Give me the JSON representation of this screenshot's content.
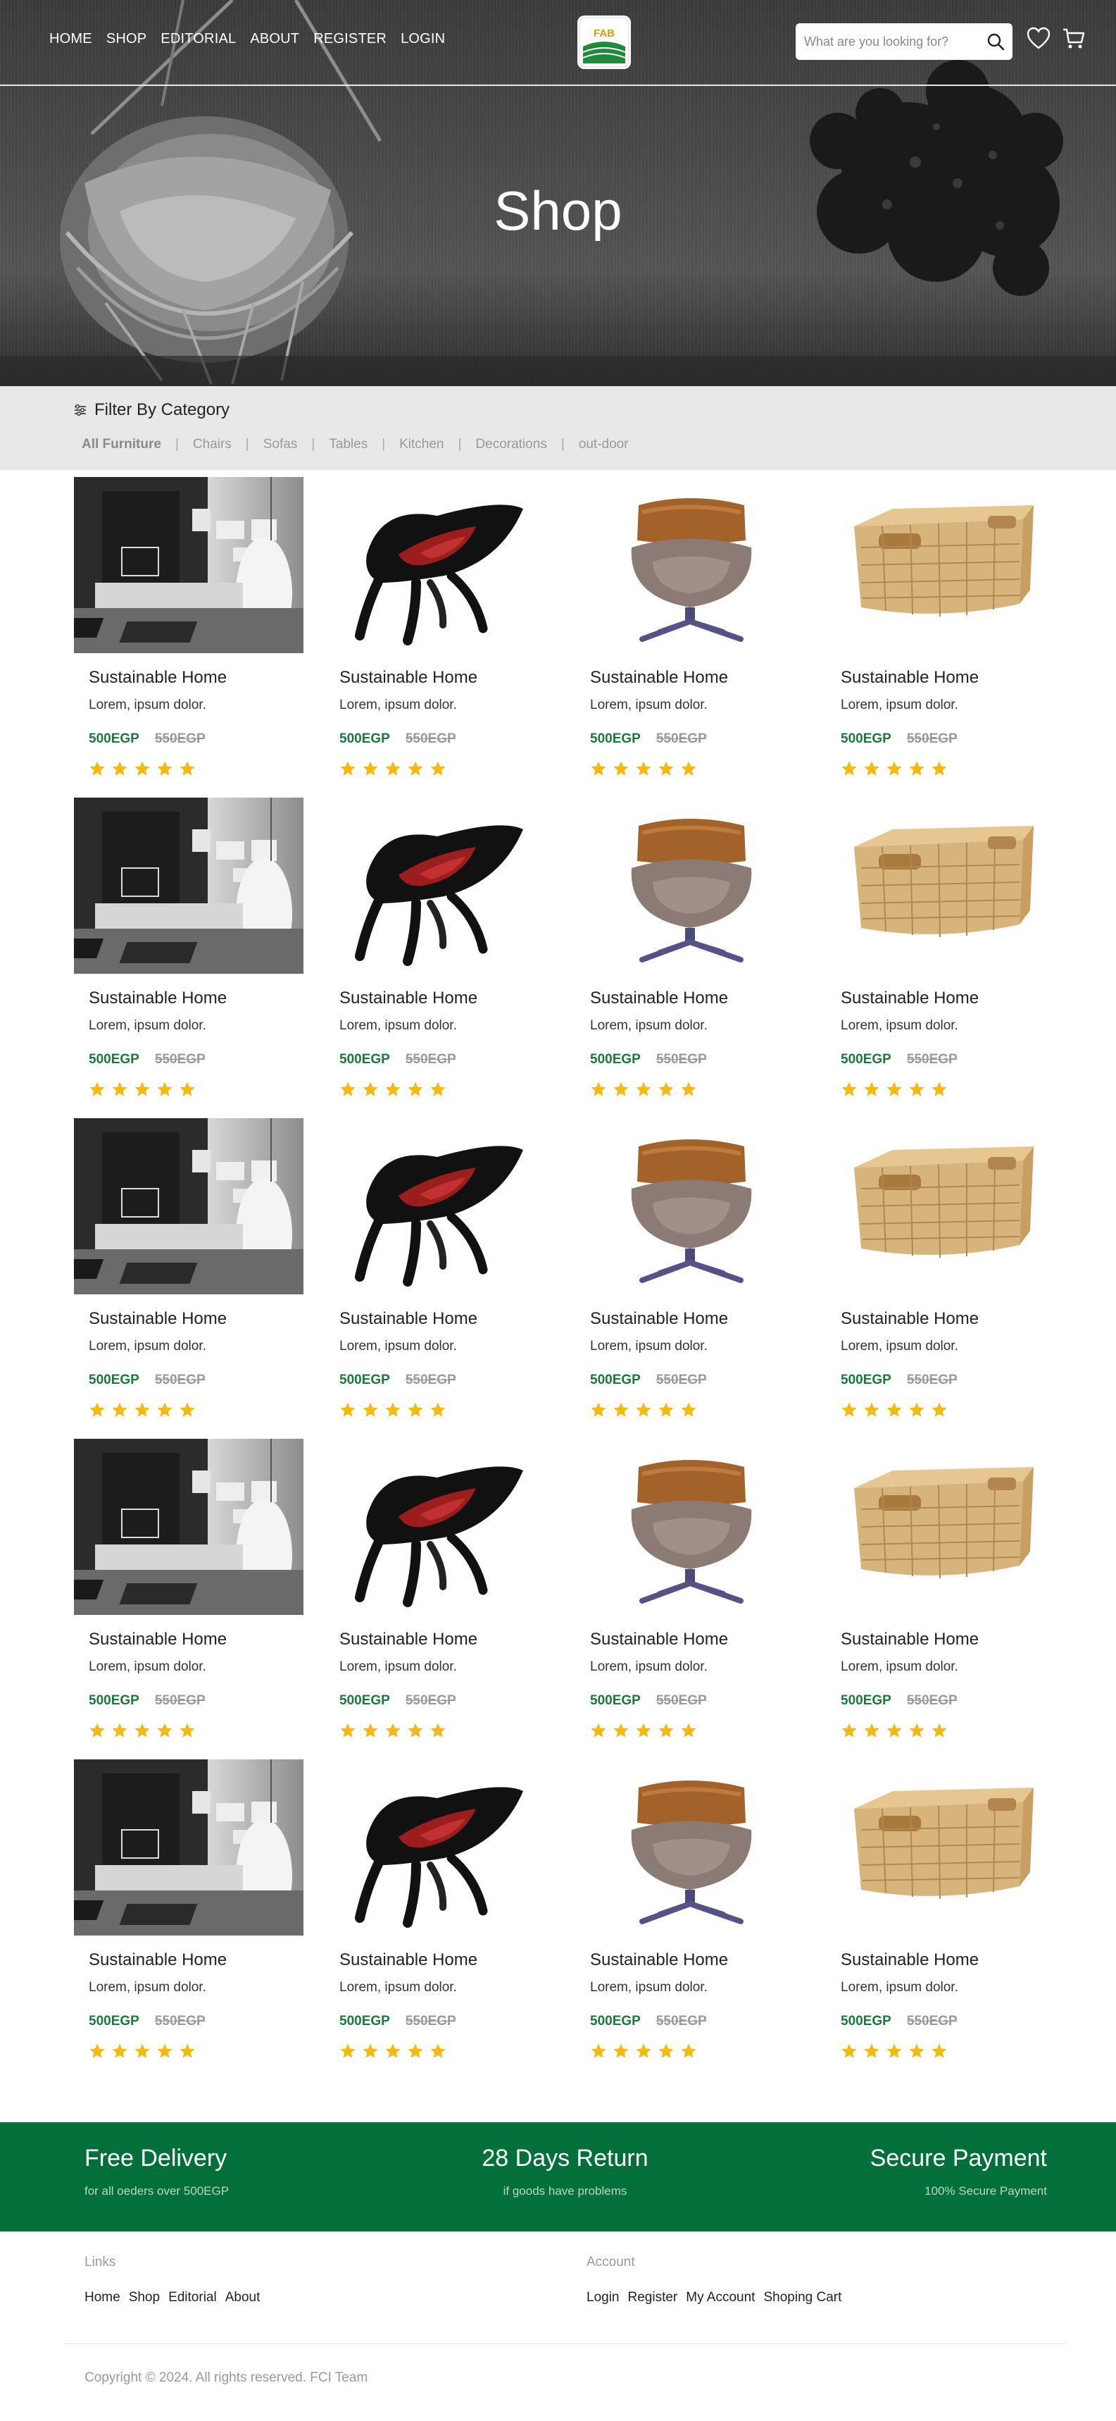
{
  "nav": {
    "items": [
      "HOME",
      "SHOP",
      "EDITORIAL",
      "ABOUT",
      "REGISTER",
      "LOGIN"
    ]
  },
  "logo": {
    "text": "FAB"
  },
  "search": {
    "placeholder": "What are you looking for?"
  },
  "icons": {
    "search": "search-icon",
    "wishlist": "heart-icon",
    "cart": "cart-icon",
    "filter": "sliders-icon",
    "rating": "star-icon"
  },
  "hero": {
    "title": "Shop"
  },
  "filter": {
    "heading": "Filter By Category",
    "categories": [
      "All Furniture",
      "Chairs",
      "Sofas",
      "Tables",
      "Kitchen",
      "Decorations",
      "out-door"
    ],
    "active": "All Furniture"
  },
  "products": [
    {
      "title": "Sustainable Home",
      "desc": "Lorem, ipsum dolor.",
      "price": "500EGP",
      "old_price": "550EGP",
      "rating": 5,
      "image": "living-room"
    },
    {
      "title": "Sustainable Home",
      "desc": "Lorem, ipsum dolor.",
      "price": "500EGP",
      "old_price": "550EGP",
      "rating": 5,
      "image": "red-chair"
    },
    {
      "title": "Sustainable Home",
      "desc": "Lorem, ipsum dolor.",
      "price": "500EGP",
      "old_price": "550EGP",
      "rating": 5,
      "image": "lounge-chair"
    },
    {
      "title": "Sustainable Home",
      "desc": "Lorem, ipsum dolor.",
      "price": "500EGP",
      "old_price": "550EGP",
      "rating": 5,
      "image": "wicker-basket"
    },
    {
      "title": "Sustainable Home",
      "desc": "Lorem, ipsum dolor.",
      "price": "500EGP",
      "old_price": "550EGP",
      "rating": 5,
      "image": "living-room"
    },
    {
      "title": "Sustainable Home",
      "desc": "Lorem, ipsum dolor.",
      "price": "500EGP",
      "old_price": "550EGP",
      "rating": 5,
      "image": "red-chair"
    },
    {
      "title": "Sustainable Home",
      "desc": "Lorem, ipsum dolor.",
      "price": "500EGP",
      "old_price": "550EGP",
      "rating": 5,
      "image": "lounge-chair"
    },
    {
      "title": "Sustainable Home",
      "desc": "Lorem, ipsum dolor.",
      "price": "500EGP",
      "old_price": "550EGP",
      "rating": 5,
      "image": "wicker-basket"
    },
    {
      "title": "Sustainable Home",
      "desc": "Lorem, ipsum dolor.",
      "price": "500EGP",
      "old_price": "550EGP",
      "rating": 5,
      "image": "living-room"
    },
    {
      "title": "Sustainable Home",
      "desc": "Lorem, ipsum dolor.",
      "price": "500EGP",
      "old_price": "550EGP",
      "rating": 5,
      "image": "red-chair"
    },
    {
      "title": "Sustainable Home",
      "desc": "Lorem, ipsum dolor.",
      "price": "500EGP",
      "old_price": "550EGP",
      "rating": 5,
      "image": "lounge-chair"
    },
    {
      "title": "Sustainable Home",
      "desc": "Lorem, ipsum dolor.",
      "price": "500EGP",
      "old_price": "550EGP",
      "rating": 5,
      "image": "wicker-basket"
    },
    {
      "title": "Sustainable Home",
      "desc": "Lorem, ipsum dolor.",
      "price": "500EGP",
      "old_price": "550EGP",
      "rating": 5,
      "image": "living-room"
    },
    {
      "title": "Sustainable Home",
      "desc": "Lorem, ipsum dolor.",
      "price": "500EGP",
      "old_price": "550EGP",
      "rating": 5,
      "image": "red-chair"
    },
    {
      "title": "Sustainable Home",
      "desc": "Lorem, ipsum dolor.",
      "price": "500EGP",
      "old_price": "550EGP",
      "rating": 5,
      "image": "lounge-chair"
    },
    {
      "title": "Sustainable Home",
      "desc": "Lorem, ipsum dolor.",
      "price": "500EGP",
      "old_price": "550EGP",
      "rating": 5,
      "image": "wicker-basket"
    },
    {
      "title": "Sustainable Home",
      "desc": "Lorem, ipsum dolor.",
      "price": "500EGP",
      "old_price": "550EGP",
      "rating": 5,
      "image": "living-room"
    },
    {
      "title": "Sustainable Home",
      "desc": "Lorem, ipsum dolor.",
      "price": "500EGP",
      "old_price": "550EGP",
      "rating": 5,
      "image": "red-chair"
    },
    {
      "title": "Sustainable Home",
      "desc": "Lorem, ipsum dolor.",
      "price": "500EGP",
      "old_price": "550EGP",
      "rating": 5,
      "image": "lounge-chair"
    },
    {
      "title": "Sustainable Home",
      "desc": "Lorem, ipsum dolor.",
      "price": "500EGP",
      "old_price": "550EGP",
      "rating": 5,
      "image": "wicker-basket"
    }
  ],
  "features": [
    {
      "title": "Free Delivery",
      "sub": "for all oeders over 500EGP"
    },
    {
      "title": "28 Days Return",
      "sub": "if goods have problems"
    },
    {
      "title": "Secure Payment",
      "sub": "100% Secure Payment"
    }
  ],
  "footer": {
    "links_heading": "Links",
    "links": [
      "Home",
      "Shop",
      "Editorial",
      "About"
    ],
    "account_heading": "Account",
    "account_links": [
      "Login",
      "Register",
      "My Account",
      "Shoping Cart"
    ],
    "copyright": "Copyright © 2024. All rights reserved. FCI Team"
  },
  "colors": {
    "brand_green": "#03703c",
    "price_green": "#1a7a3b",
    "star": "#f5b90f",
    "filter_bg": "#e8e8e8"
  }
}
